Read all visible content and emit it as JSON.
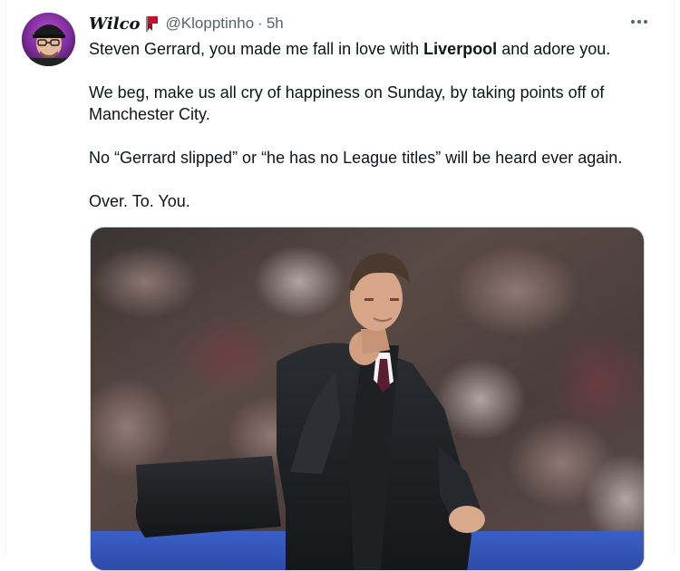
{
  "tweet": {
    "author": {
      "display_name": "Wilco",
      "name_emoji_icon": "scarf-flag-icon",
      "handle": "@Klopptinho",
      "avatar_icon": "avatar-photo"
    },
    "separator": "·",
    "time": "5h",
    "more_icon": "more-icon",
    "text": {
      "p1_before": "Steven Gerrard, you made me fall in love with ",
      "p1_bold": "Liverpool",
      "p1_after": " and adore you.",
      "p2": "We beg, make us all cry of happiness on Sunday, by taking points off of Manchester City.",
      "p3": "No “Gerrard slipped” or “he has no League titles” will be heard ever again.",
      "p4": "Over. To. You."
    },
    "media": {
      "kind": "photo",
      "icon": "photo-man-in-coat"
    }
  },
  "colors": {
    "text_primary": "#0f1419",
    "text_secondary": "#536471",
    "border": "#cfd9de",
    "flag_red": "#c8102e"
  }
}
